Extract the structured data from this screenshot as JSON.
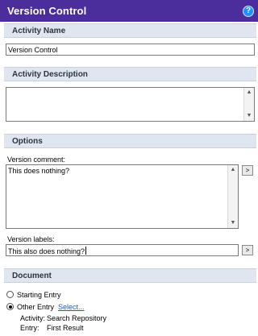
{
  "window": {
    "title": "Version Control",
    "help_glyph": "?"
  },
  "activity_name": {
    "header": "Activity Name",
    "value": "Version Control"
  },
  "activity_description": {
    "header": "Activity Description",
    "value": ""
  },
  "options": {
    "header": "Options",
    "version_comment_label": "Version comment:",
    "version_comment_value": "This does nothing?",
    "version_labels_label": "Version labels:",
    "version_labels_value": "This also does nothing?",
    "expand_button_glyph": ">"
  },
  "document": {
    "header": "Document",
    "starting_entry_label": "Starting Entry",
    "other_entry_label": "Other Entry",
    "select_link": "Select...",
    "activity_label": "Activity:",
    "activity_value": "Search Repository",
    "entry_label": "Entry:",
    "entry_value": "First Result",
    "selected": "other_entry"
  },
  "icons": {
    "scroll_up": "▲",
    "scroll_down": "▼"
  }
}
